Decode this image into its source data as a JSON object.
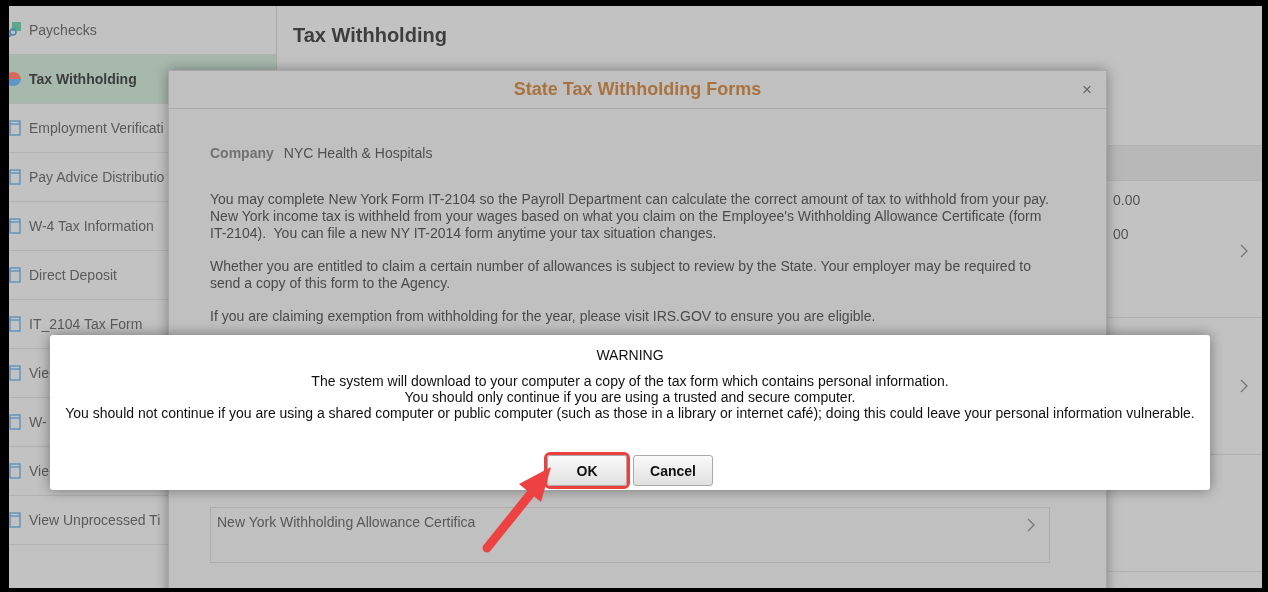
{
  "sidebar": {
    "items": [
      {
        "label": "Paychecks",
        "selected": false
      },
      {
        "label": "Tax Withholding",
        "selected": true
      },
      {
        "label": "Employment Verificati",
        "selected": false
      },
      {
        "label": "Pay Advice Distributio",
        "selected": false
      },
      {
        "label": "W-4 Tax Information",
        "selected": false
      },
      {
        "label": "Direct Deposit",
        "selected": false
      },
      {
        "label": "IT_2104 Tax Form",
        "selected": false
      },
      {
        "label": "Vie",
        "selected": false
      },
      {
        "label": "W-",
        "selected": false
      },
      {
        "label": "Vie",
        "selected": false
      },
      {
        "label": "View Unprocessed Ti",
        "selected": false
      }
    ]
  },
  "page": {
    "title": "Tax Withholding",
    "amounts": [
      "0.00",
      "00"
    ]
  },
  "modal": {
    "title": "State Tax Withholding Forms",
    "close": "×",
    "company_label": "Company",
    "company": "NYC Health & Hospitals",
    "paragraphs": [
      "You may complete New York Form IT-2104 so the Payroll Department can calculate the correct amount of tax to withhold from your pay.  New York income tax is withheld from your wages based on what you claim on the Employee's Withholding Allowance Certificate (form IT-2104).  You can file a new NY IT-2014 form anytime your tax situation changes.",
      "Whether you are entitled to claim a certain number of allowances is subject to review by the State. Your employer may be required to send a copy of this form to the Agency.",
      "If you are claiming exemption from withholding for the year, please visit IRS.GOV to ensure you are eligible."
    ],
    "form_link": "New York Withholding Allowance Certifica"
  },
  "warning": {
    "title": "WARNING",
    "lines": [
      "The system will download to your computer a copy of the tax form which contains personal information.",
      "You should only continue if you are using a trusted and secure computer.",
      "You should not continue if you are using a shared computer or public computer (such as those in a library or internet café); doing this could leave your personal information vulnerable."
    ],
    "buttons": [
      {
        "label": "OK",
        "highlighted": true
      },
      {
        "label": "Cancel",
        "highlighted": false
      }
    ]
  }
}
